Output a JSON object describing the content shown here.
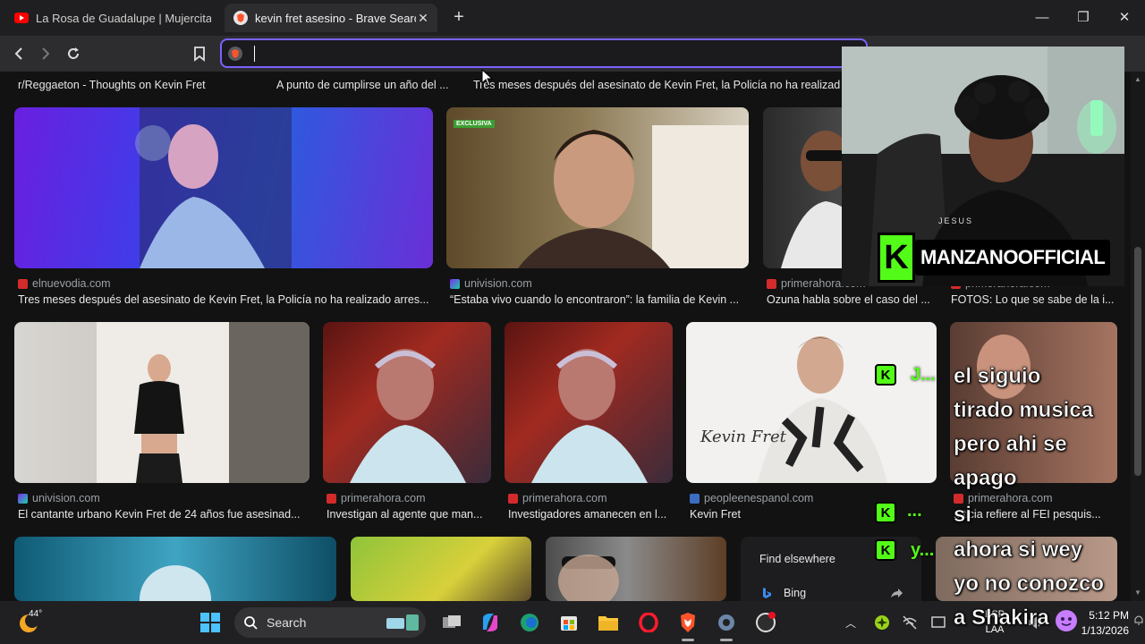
{
  "browser": {
    "tabs": [
      {
        "title": "La Rosa de Guadalupe | Mujercitas [F",
        "favicon": "youtube-icon"
      },
      {
        "title": "kevin fret asesino - Brave Search",
        "favicon": "brave-icon",
        "active": true
      }
    ],
    "new_tab_label": "+",
    "window_controls": {
      "minimize": "—",
      "maximize": "❐",
      "close": "✕"
    },
    "address_bar": {
      "value": "",
      "placeholder": ""
    }
  },
  "results": {
    "top_row": [
      "r/Reggaeton - Thoughts on Kevin Fret",
      "A punto de cumplirse un año del ...",
      "Tres meses después del asesinato de Kevin Fret, la Policía no ha realizad"
    ],
    "row1": [
      {
        "source": "elnuevodia.com",
        "caption": "Tres meses después del asesinato de Kevin Fret, la Policía no ha realizado arres..."
      },
      {
        "source": "univision.com",
        "caption": "“Estaba vivo cuando lo encontraron”: la familia de Kevin ...",
        "badge": "EXCLUSIVA"
      },
      {
        "source": "primerahora.com",
        "caption": "Ozuna habla sobre el caso del ..."
      },
      {
        "source": "primerahora.com",
        "caption": "FOTOS: Lo que se sabe de la i..."
      }
    ],
    "row2": [
      {
        "source": "univision.com",
        "caption": "El cantante urbano Kevin Fret de 24 años fue asesinad..."
      },
      {
        "source": "primerahora.com",
        "caption": "Investigan al agente que man..."
      },
      {
        "source": "primerahora.com",
        "caption": "Investigadores amanecen en l..."
      },
      {
        "source": "peopleenespanol.com",
        "caption": "Kevin Fret",
        "signature": "Kevin Fret"
      },
      {
        "source": "primerahora.com",
        "caption": "...ticia refiere al FEI pesquis..."
      }
    ],
    "find_elsewhere": {
      "title": "Find elsewhere",
      "engine": "Bing"
    }
  },
  "stream_overlay": {
    "channel": "MANZANOOFFICIAL",
    "hoodie_text": "JESUS",
    "chat_lines": [
      "el siguio",
      "tirado musica",
      "pero ahi se",
      "apago",
      "si",
      "ahora si wey",
      "yo no conozco",
      "a Shakira"
    ],
    "chat_tails": [
      "J...",
      "...",
      "y..."
    ],
    "colors": {
      "kick_green": "#53fc18"
    }
  },
  "taskbar": {
    "weather_temp": "44°",
    "search_label": "Search",
    "lang_top": "ESP",
    "lang_bottom": "LAA",
    "time": "5:12 PM",
    "date": "1/13/2026"
  },
  "colors": {
    "url_focus": "#7b61ff",
    "brave_orange": "#fb542b",
    "youtube_red": "#ff0000"
  }
}
